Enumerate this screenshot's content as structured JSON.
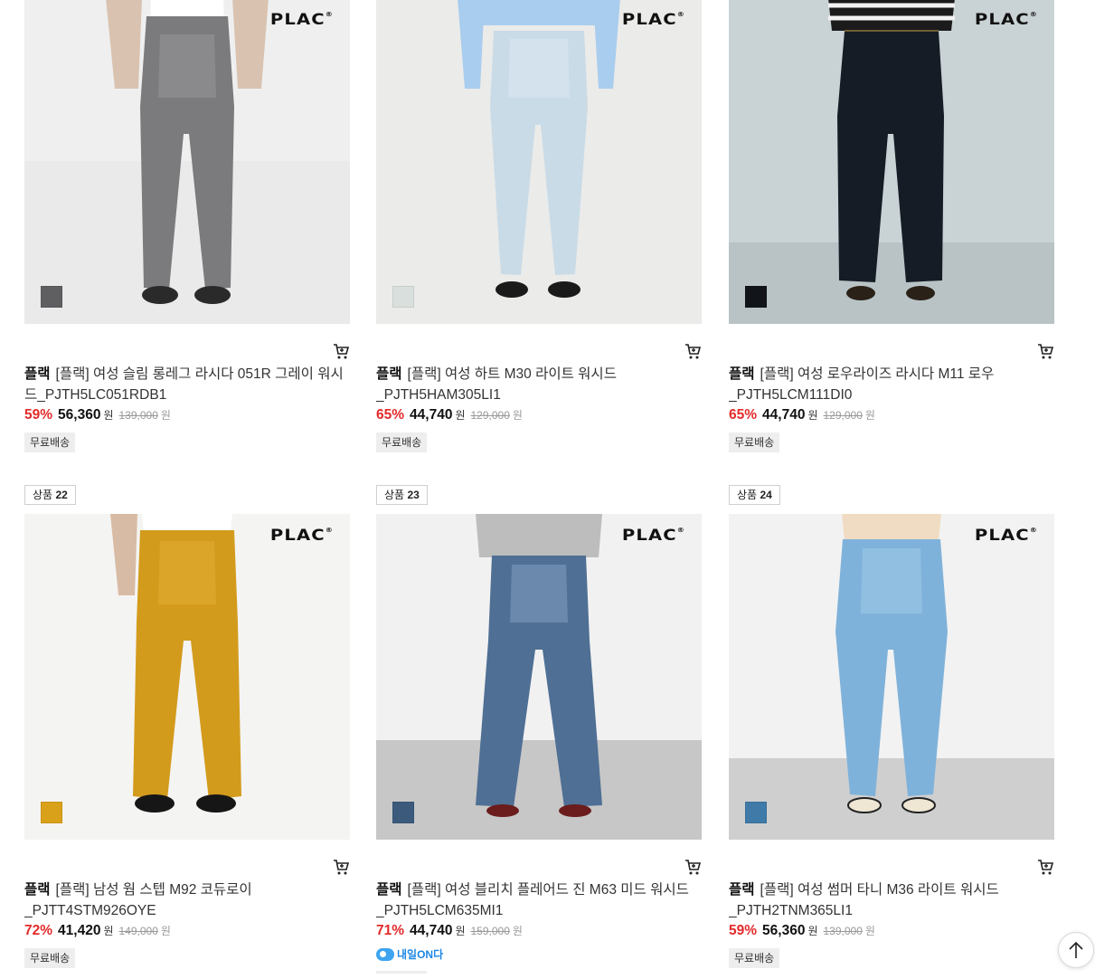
{
  "products": [
    {
      "brand": "플랙",
      "name": "[플랙] 여성 슬림 롱레그 라시다 051R 그레이 워시드_PJTH5LC051RDB1",
      "discount": "59%",
      "price": "56,360",
      "original_price": "139,000",
      "currency": "원",
      "tag": "무료배송",
      "swatch_color": "#5f5f62",
      "logo": "PLAC",
      "logo_mark": "®"
    },
    {
      "brand": "플랙",
      "name": "[플랙] 여성 하트 M30 라이트 워시드_PJTH5HAM305LI1",
      "discount": "65%",
      "price": "44,740",
      "original_price": "129,000",
      "currency": "원",
      "tag": "무료배송",
      "swatch_color": "#d8dfdc",
      "logo": "PLAC",
      "logo_mark": "®"
    },
    {
      "brand": "플랙",
      "name": "[플랙] 여성 로우라이즈 라시다 M11 로우_PJTH5LCM111DI0",
      "discount": "65%",
      "price": "44,740",
      "original_price": "129,000",
      "currency": "원",
      "tag": "무료배송",
      "swatch_color": "#111418",
      "logo": "PLAC",
      "logo_mark": "®"
    },
    {
      "rank_label": "상품",
      "rank": "22",
      "brand": "플랙",
      "name": "[플랙] 남성 웜 스텝 M92 코듀로이_PJTT4STM926OYE",
      "discount": "72%",
      "price": "41,420",
      "original_price": "149,000",
      "currency": "원",
      "tag": "무료배송",
      "swatch_color": "#d9a019",
      "logo": "PLAC",
      "logo_mark": "®"
    },
    {
      "rank_label": "상품",
      "rank": "23",
      "brand": "플랙",
      "name": "[플랙] 여성 블리치 플레어드 진 M63 미드 워시드_PJTH5LCM635MI1",
      "discount": "71%",
      "price": "44,740",
      "original_price": "159,000",
      "currency": "원",
      "tag": "내일ON다",
      "swatch_color": "#3b5a7c",
      "logo": "PLAC",
      "logo_mark": "®"
    },
    {
      "rank_label": "상품",
      "rank": "24",
      "brand": "플랙",
      "name": "[플랙] 여성 썸머 타니 M36 라이트 워시드_PJTH2TNM365LI1",
      "discount": "59%",
      "price": "56,360",
      "original_price": "139,000",
      "currency": "원",
      "tag": "무료배송",
      "swatch_color": "#3f7aa8",
      "logo": "PLAC",
      "logo_mark": "®"
    }
  ],
  "icons": {
    "cart": "cart-icon",
    "scroll_top": "arrow-up-icon"
  }
}
